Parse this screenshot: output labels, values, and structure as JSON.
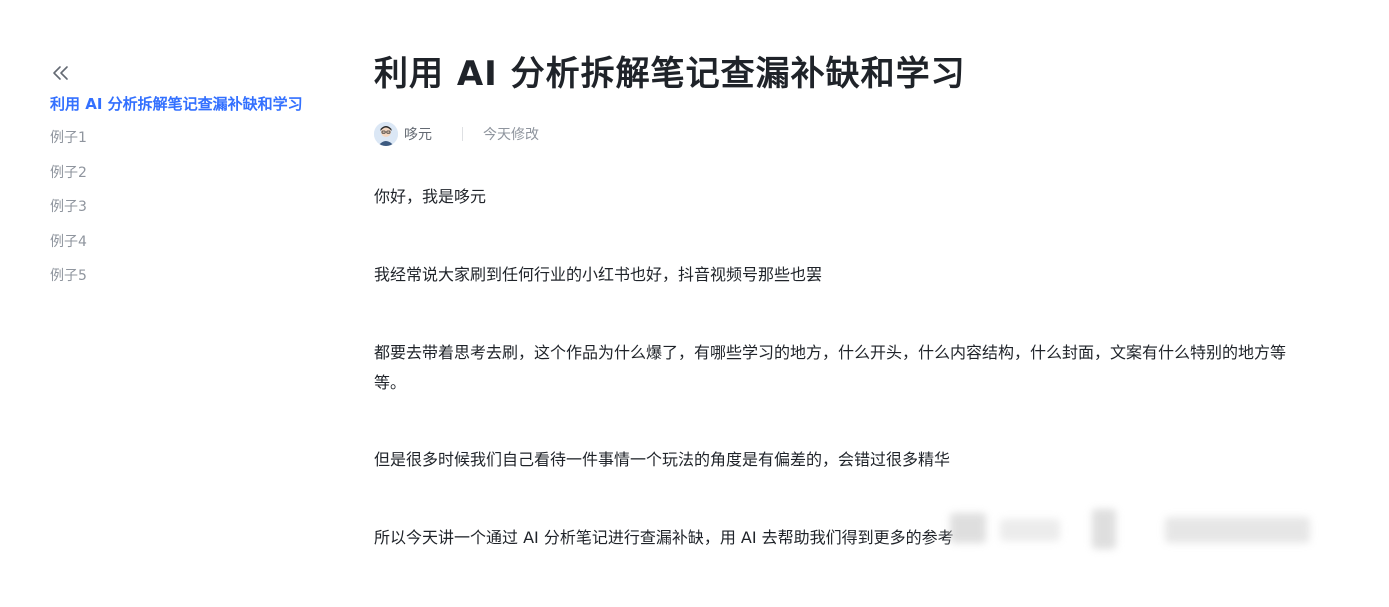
{
  "sidebar": {
    "collapse_icon": "double-chevron-left-icon",
    "items": [
      {
        "label": "利用 AI 分析拆解笔记查漏补缺和学习",
        "active": true
      },
      {
        "label": "例子1",
        "active": false
      },
      {
        "label": "例子2",
        "active": false
      },
      {
        "label": "例子3",
        "active": false
      },
      {
        "label": "例子4",
        "active": false
      },
      {
        "label": "例子5",
        "active": false
      }
    ]
  },
  "document": {
    "title": "利用 AI 分析拆解笔记查漏补缺和学习",
    "author": "哆元",
    "modified": "今天修改",
    "paragraphs": [
      "你好，我是哆元",
      "我经常说大家刷到任何行业的小红书也好，抖音视频号那些也罢",
      "都要去带着思考去刷，这个作品为什么爆了，有哪些学习的地方，什么开头，什么内容结构，什么封面，文案有什么特别的地方等等。",
      "但是很多时候我们自己看待一件事情一个玩法的角度是有偏差的，会错过很多精华",
      "所以今天讲一个通过 AI 分析笔记进行查漏补缺，用 AI 去帮助我们得到更多的参考"
    ]
  },
  "colors": {
    "accent": "#3370ff",
    "text": "#1f2329",
    "muted": "#8f959e"
  }
}
